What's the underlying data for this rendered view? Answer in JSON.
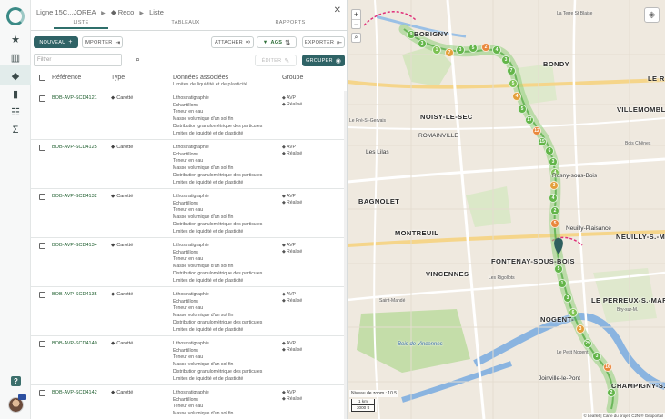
{
  "breadcrumb": {
    "project": "Ligne 15C...JOREA",
    "section": "Reco",
    "page": "Liste"
  },
  "tabs": [
    {
      "label": "LISTE"
    },
    {
      "label": "TABLEAUX"
    },
    {
      "label": "RAPPORTS"
    }
  ],
  "toolbar": {
    "new_label": "NOUVEAU",
    "import_label": "IMPORTER",
    "attach_label": "ATTACHER",
    "tags_label": "AGS",
    "export_label": "EXPORTER",
    "edit_label": "ÉDITER",
    "group_label": "GROUPER"
  },
  "filter": {
    "placeholder": "Filtrer"
  },
  "table": {
    "headers": {
      "reference": "Référence",
      "type": "Type",
      "data": "Données associées",
      "group": "Groupe"
    },
    "clipped_text": "Limites de liquidité et de plasticité",
    "rows": [
      {
        "ref": "BOB-AVP-SCD4121",
        "type": "Carotté",
        "data": [
          "Lithostratigraphie",
          "Echantillons",
          "Teneur en eau",
          "Masse volumique d'un sol fin",
          "Distribution granulométrique des particules",
          "Limites de liquidité et de plasticité"
        ],
        "groups": [
          "AVP",
          "Réalisé"
        ]
      },
      {
        "ref": "BOB-AVP-SCD4125",
        "type": "Carotté",
        "data": [
          "Lithostratigraphie",
          "Echantillons",
          "Teneur en eau",
          "Masse volumique d'un sol fin",
          "Distribution granulométrique des particules",
          "Limites de liquidité et de plasticité"
        ],
        "groups": [
          "AVP",
          "Réalisé"
        ]
      },
      {
        "ref": "BOB-AVP-SCD4132",
        "type": "Carotté",
        "data": [
          "Lithostratigraphie",
          "Echantillons",
          "Teneur en eau",
          "Masse volumique d'un sol fin",
          "Distribution granulométrique des particules",
          "Limites de liquidité et de plasticité"
        ],
        "groups": [
          "AVP",
          "Réalisé"
        ]
      },
      {
        "ref": "BOB-AVP-SCD4134",
        "type": "Carotté",
        "data": [
          "Lithostratigraphie",
          "Echantillons",
          "Teneur en eau",
          "Masse volumique d'un sol fin",
          "Distribution granulométrique des particules",
          "Limites de liquidité et de plasticité"
        ],
        "groups": [
          "AVP",
          "Réalisé"
        ]
      },
      {
        "ref": "BOB-AVP-SCD4135",
        "type": "Carotté",
        "data": [
          "Lithostratigraphie",
          "Echantillons",
          "Teneur en eau",
          "Masse volumique d'un sol fin",
          "Distribution granulométrique des particules",
          "Limites de liquidité et de plasticité"
        ],
        "groups": [
          "AVP",
          "Réalisé"
        ]
      },
      {
        "ref": "BOB-AVP-SCD4140",
        "type": "Carotté",
        "data": [
          "Lithostratigraphie",
          "Echantillons",
          "Teneur en eau",
          "Masse volumique d'un sol fin",
          "Distribution granulométrique des particules",
          "Limites de liquidité et de plasticité"
        ],
        "groups": [
          "AVP",
          "Réalisé"
        ]
      },
      {
        "ref": "BOB-AVP-SCD4142",
        "type": "Carotté",
        "data": [
          "Lithostratigraphie",
          "Echantillons",
          "Teneur en eau",
          "Masse volumique d'un sol fin"
        ],
        "groups": [
          "AVP",
          "Réalisé"
        ]
      }
    ]
  },
  "map": {
    "places": [
      "BOBIGNY",
      "BONDY",
      "NOISY-LE-SEC",
      "ROMAINVILLE",
      "Les Lilas",
      "BAGNOLET",
      "MONTREUIL",
      "VINCENNES",
      "FONTENAY-SOUS-BOIS",
      "NOGENT-",
      "LE PERREUX-S.-MARNE",
      "VILLEMOMBLE",
      "NEUILLY-S.-MARNE",
      "Joinville-le-Pont",
      "CHAMPIGNY-S.-MARNE",
      "Bois de Vincennes",
      "Neuilly-Plaisance",
      "La Terre St Blaise",
      "Rosny-sous-Bois",
      "Les Rigollots",
      "Saint-Mandé",
      "Bry-sur-M.",
      "LE RAI",
      "Bois Chênes",
      "Le Pré-St-Gervais",
      "Le Petit Nogent"
    ],
    "markers": [
      "9",
      "3",
      "1",
      "7",
      "3",
      "5",
      "2",
      "4",
      "3",
      "7",
      "5",
      "4",
      "5",
      "17",
      "12",
      "15",
      "6",
      "3",
      "4",
      "3",
      "4",
      "2",
      "5",
      "5",
      "1",
      "3",
      "6",
      "3",
      "29",
      "3",
      "16",
      "2"
    ],
    "zoom_label": "Niveau de zoom : 10.5",
    "scale_km": "1 km",
    "scale_ft": "3000 ft",
    "attribution": "© Leaflet | Carte du projet, C2N ® Geoportail"
  }
}
